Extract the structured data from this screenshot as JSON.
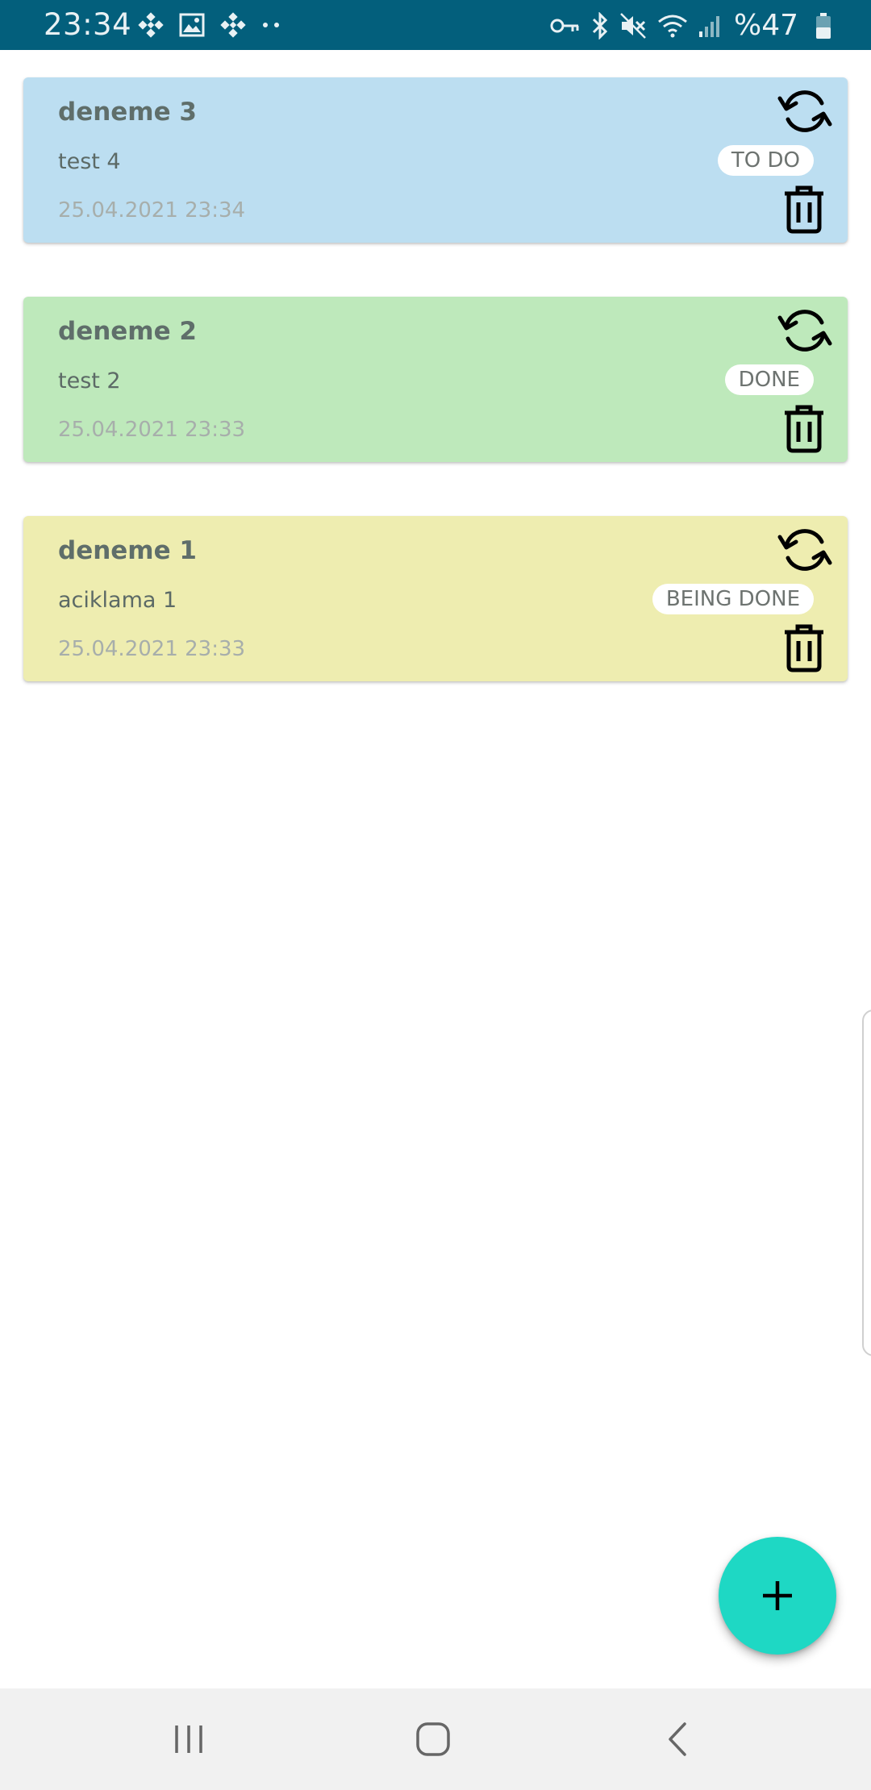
{
  "status_bar": {
    "time": "23:34",
    "left_icons": [
      "binance-icon",
      "gallery-icon",
      "binance-icon",
      "more-dots-icon"
    ],
    "right_icons": [
      "vpn-key-icon",
      "bluetooth-icon",
      "mute-icon",
      "wifi-icon",
      "signal-icon"
    ],
    "battery_percent": "%47",
    "background": "#035f7c"
  },
  "tasks": [
    {
      "title": "deneme 3",
      "description": "test 4",
      "date": "25.04.2021 23:34",
      "status": "TO DO",
      "color": "#bcdef1"
    },
    {
      "title": "deneme 2",
      "description": "test 2",
      "date": "25.04.2021 23:33",
      "status": "DONE",
      "color": "#bee9bb"
    },
    {
      "title": "deneme 1",
      "description": "aciklama 1",
      "date": "25.04.2021 23:33",
      "status": "BEING DONE",
      "color": "#eeedb0"
    }
  ],
  "fab": {
    "icon": "plus-icon",
    "color": "#1ed8c4"
  },
  "navigation": {
    "items": [
      {
        "name": "recent-apps",
        "icon": "recent-apps-icon"
      },
      {
        "name": "home",
        "icon": "home-icon"
      },
      {
        "name": "back",
        "icon": "back-icon"
      }
    ]
  }
}
